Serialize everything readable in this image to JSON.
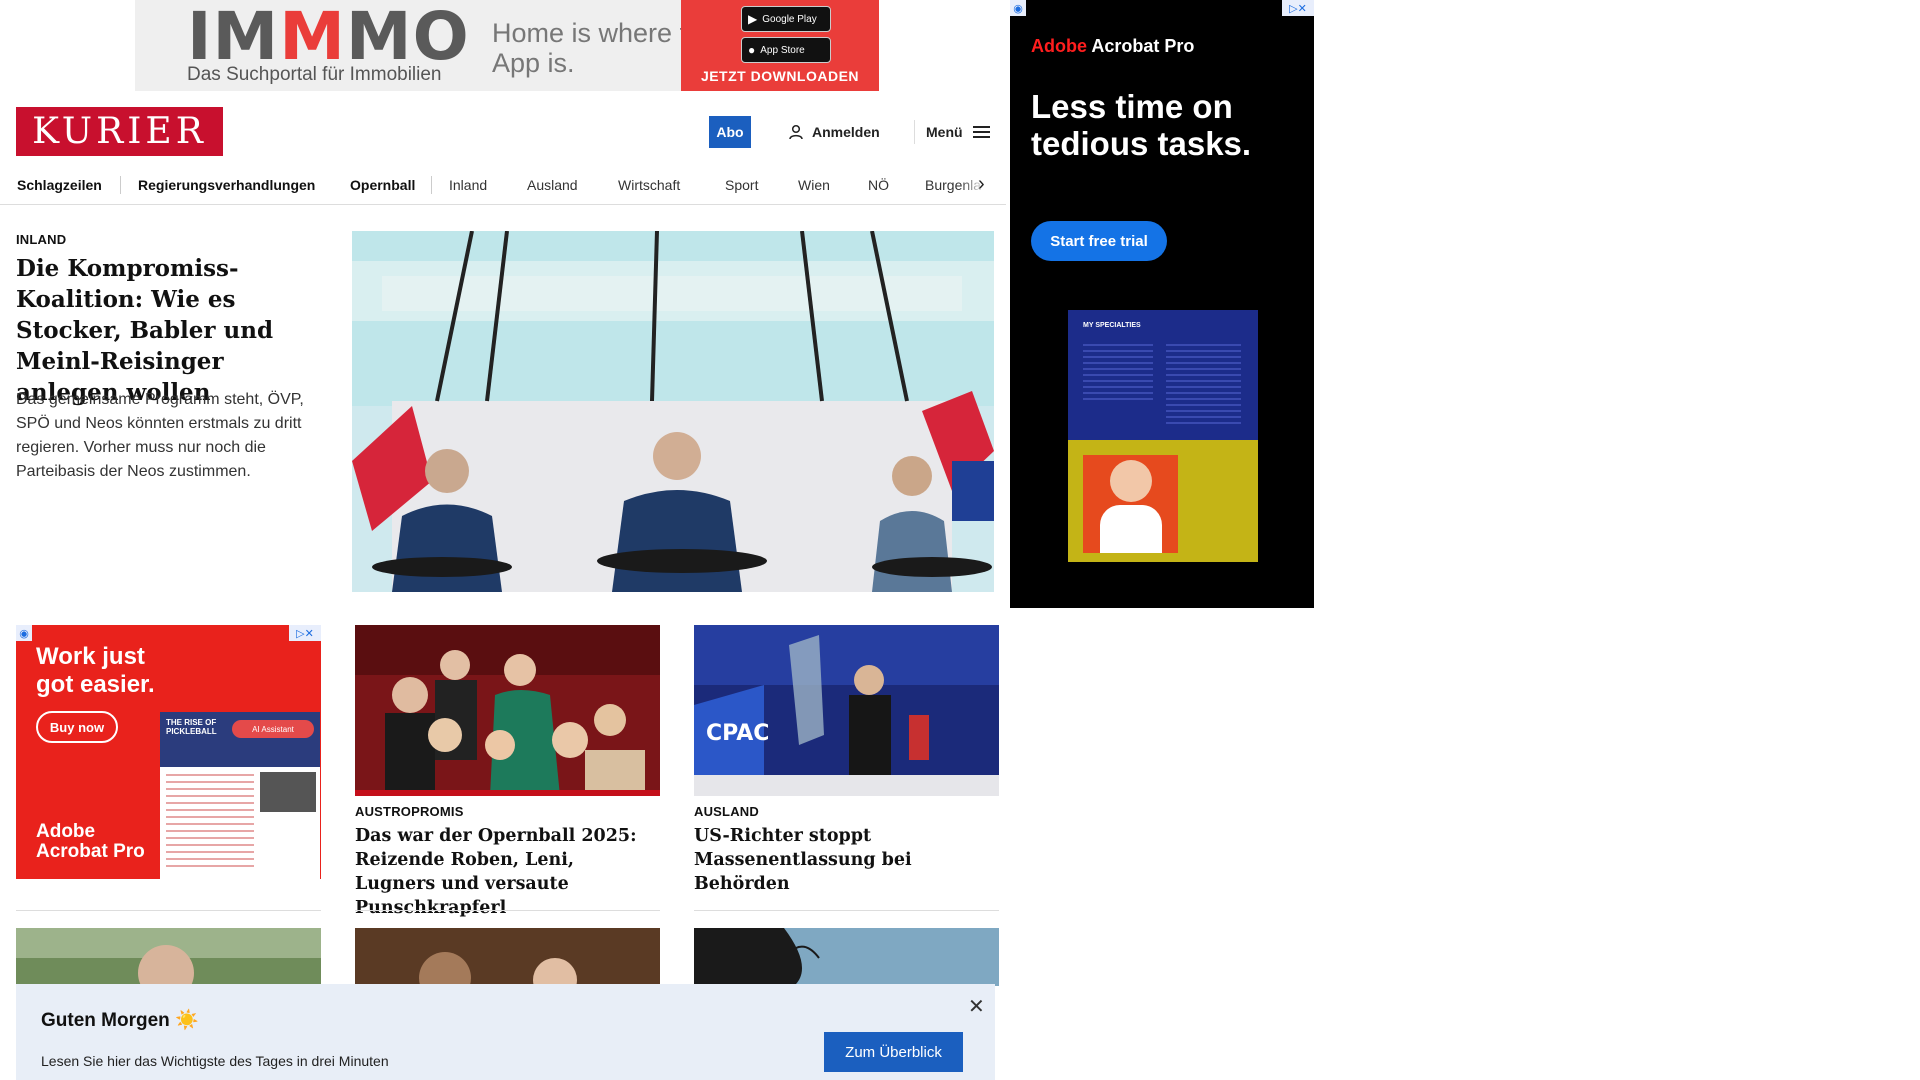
{
  "top_ad": {
    "logo_im": "IM",
    "logo_mm": "M",
    "logo_o": "O",
    "subtitle": "Das Suchportal für Immobilien",
    "claim": "Home is where the App is.",
    "google_play": "Google Play",
    "app_store": "App Store",
    "cta": "JETZT DOWNLOADEN"
  },
  "header": {
    "brand": "KURIER",
    "abo": "Abo",
    "login": "Anmelden",
    "menu": "Menü"
  },
  "nav": {
    "items": [
      "Schlagzeilen",
      "Regierungsverhandlungen",
      "Opernball",
      "Inland",
      "Ausland",
      "Wirtschaft",
      "Sport",
      "Wien",
      "NÖ",
      "Burgenla"
    ]
  },
  "lead": {
    "kicker": "INLAND",
    "title": "Die Kompromiss-Koalition: Wie es Stocker, Babler und Meinl-Reisinger anlegen wollen",
    "teaser": "Das gemeinsame Programm steht, ÖVP, SPÖ und Neos könnten erstmals zu dritt regieren. Vorher muss nur noch die Parteibasis der Neos zustimmen."
  },
  "right_ad": {
    "brand_adobe": "Adobe",
    "brand_product": "Acrobat Pro",
    "headline": "Less time on tedious tasks.",
    "cta": "Start free trial",
    "doc_title": "MY SPECIALTIES"
  },
  "card_ad": {
    "headline": "Work just got easier.",
    "cta": "Buy now",
    "brand_adobe": "Adobe",
    "brand_product": "Acrobat Pro",
    "doc_title": "THE RISE OF PICKLEBALL",
    "assistant": "AI Assistant"
  },
  "cards": [
    {
      "kicker": "AUSTROPROMIS",
      "title": "Das war der Opernball 2025: Reizende Roben, Leni, Lugners und versaute Punschkrapferl"
    },
    {
      "kicker": "AUSLAND",
      "title": "US-Richter stoppt Massenentlassung bei Behörden"
    }
  ],
  "greeting": {
    "title": "Guten Morgen ☀️",
    "subtitle": "Lesen Sie hier das Wichtigste des Tages in drei Minuten",
    "button": "Zum Überblick"
  },
  "colors": {
    "brand_red": "#c8102e",
    "accent_blue": "#1b5fbf",
    "adobe_red": "#e9221c"
  },
  "icons": [
    "user-icon",
    "hamburger-icon",
    "chevron-right-icon",
    "close-icon",
    "adchoices-icon"
  ]
}
